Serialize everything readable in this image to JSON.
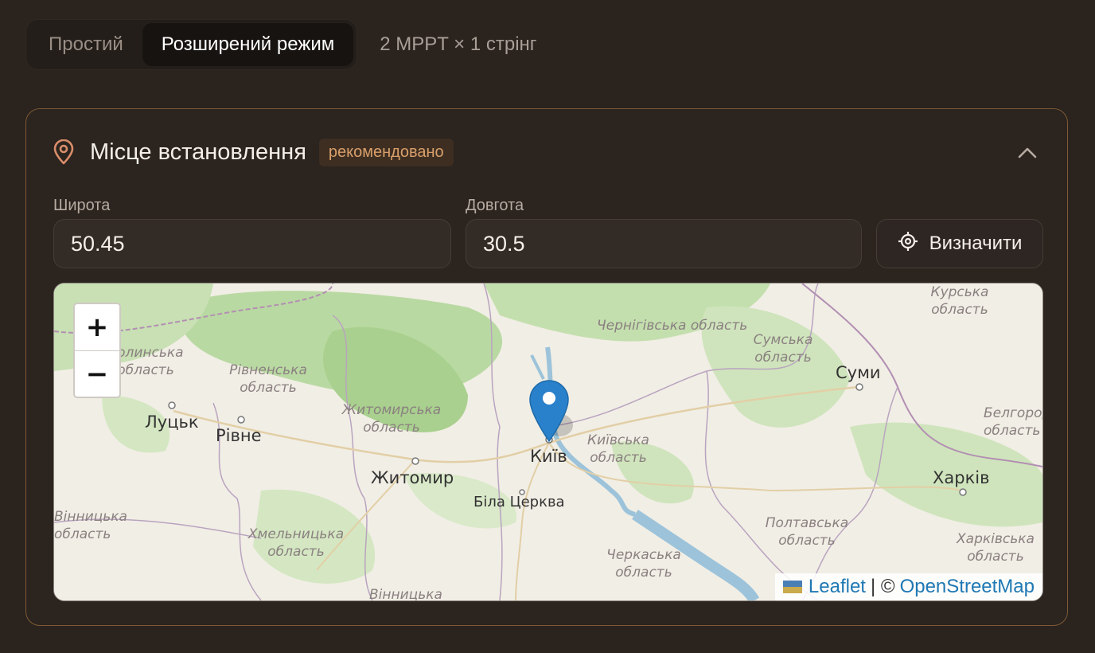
{
  "mode": {
    "simple_label": "Простий",
    "advanced_label": "Розширений режим",
    "active": "advanced",
    "summary": "2 MPPT × 1 стрінг"
  },
  "location": {
    "title": "Місце встановлення",
    "badge": "рекомендовано",
    "latitude_label": "Широта",
    "latitude_value": "50.45",
    "longitude_label": "Довгота",
    "longitude_value": "30.5",
    "locate_label": "Визначити"
  },
  "map": {
    "zoom_in": "+",
    "zoom_out": "−",
    "attribution": {
      "leaflet": "Leaflet",
      "separator": "| ©",
      "osm": "OpenStreetMap"
    },
    "cities": [
      "Луцьк",
      "Рівне",
      "Житомир",
      "Київ",
      "Біла Церква",
      "Суми",
      "Харків"
    ],
    "regions": [
      "Чернігівська область",
      "Сумська область",
      "Рівненська область",
      "Житомирська область",
      "Київська область",
      "Хмельницька область",
      "Черкаська область",
      "Полтавська область",
      "Харківська область",
      "Курська область",
      "Белгородська область",
      "Вінницька",
      "Волинська область",
      "Вінницька область"
    ]
  },
  "colors": {
    "accent": "#d99f6a",
    "card_border": "#7d5a34",
    "marker": "#2a81cb"
  }
}
